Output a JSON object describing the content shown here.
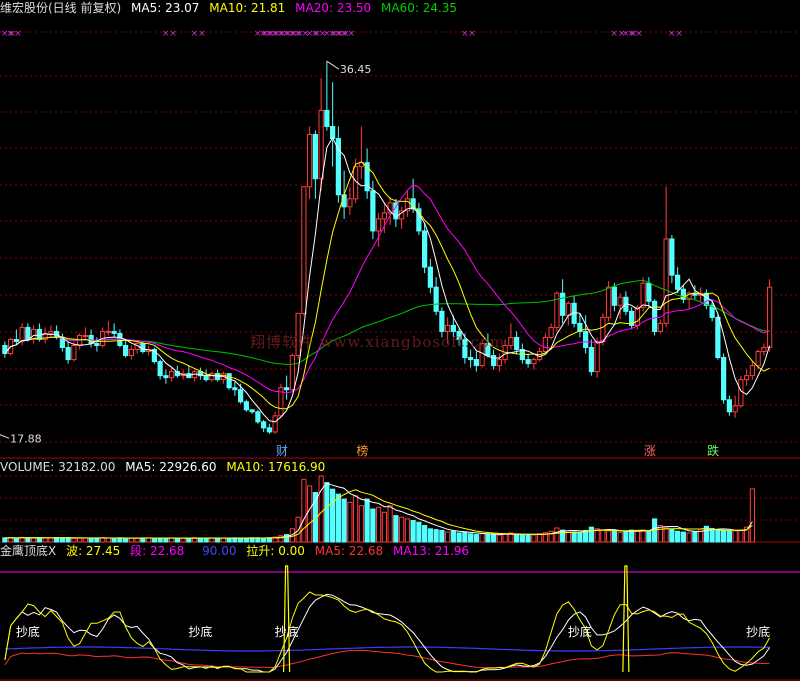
{
  "price_header": {
    "name": "维宏股份(日线 前复权)",
    "ma5": "MA5: 23.07",
    "ma10": "MA10: 21.81",
    "ma20": "MA20: 23.50",
    "ma60": "MA60: 24.35"
  },
  "volume_header": {
    "title": "VOLUME: 32182.00",
    "ma5": "MA5: 22926.60",
    "ma10": "MA10: 17616.90"
  },
  "indicator_header": {
    "title": "金鹰顶底X",
    "wave": "波: 27.45",
    "segment": "段: 22.68",
    "level": "90.00",
    "pull": "拉升: 0.00",
    "ma5": "MA5: 22.68",
    "ma13": "MA13: 21.96"
  },
  "annotations": {
    "high_label": "36.45",
    "low_label": "17.88",
    "markers": [
      "财",
      "榜",
      "涨",
      "跌"
    ],
    "signal_text": "抄底",
    "cross": "××",
    "watermark": "翔博软件 www.xiangbosoft.com"
  },
  "colors": {
    "up": "#ff3c3c",
    "down": "#54ffff",
    "ma5": "#ffffff",
    "ma10": "#ffff00",
    "ma20": "#ff00ff",
    "ma60": "#00c000",
    "grid": "#8b0000",
    "indicator_wave": "#ffff00",
    "indicator_segment": "#ffffff",
    "indicator_base": "#3c3cff",
    "indicator_mid": "#ff3030",
    "indicator_top": "#ff00ff"
  },
  "chart_data": [
    {
      "type": "candlestick",
      "title": "维宏股份(日线 前复权)",
      "ylim": [
        17,
        38
      ],
      "high_marker": 36.45,
      "low_marker": 17.88,
      "series": [
        {
          "name": "MA5"
        },
        {
          "name": "MA10"
        },
        {
          "name": "MA20"
        },
        {
          "name": "MA60"
        }
      ],
      "candles": [
        [
          22.3,
          22.5,
          21.7,
          21.9
        ],
        [
          21.9,
          22.7,
          21.8,
          22.6
        ],
        [
          22.6,
          23.1,
          22.3,
          22.5
        ],
        [
          22.5,
          23.4,
          22.3,
          23.2
        ],
        [
          23.2,
          23.4,
          22.5,
          22.6
        ],
        [
          22.6,
          23.3,
          22.4,
          23.1
        ],
        [
          23.1,
          23.4,
          22.5,
          22.6
        ],
        [
          22.6,
          23.2,
          22.4,
          22.9
        ],
        [
          22.9,
          23.3,
          22.7,
          23.0
        ],
        [
          23.0,
          23.3,
          22.6,
          22.7
        ],
        [
          22.7,
          22.9,
          22.0,
          22.2
        ],
        [
          22.2,
          22.5,
          21.4,
          21.6
        ],
        [
          21.6,
          22.5,
          21.5,
          22.3
        ],
        [
          22.3,
          22.9,
          22.1,
          22.8
        ],
        [
          22.8,
          23.2,
          22.6,
          22.8
        ],
        [
          22.8,
          23.1,
          22.2,
          22.4
        ],
        [
          22.4,
          22.7,
          22.0,
          22.3
        ],
        [
          22.3,
          23.2,
          22.2,
          23.0
        ],
        [
          23.0,
          23.5,
          22.8,
          23.0
        ],
        [
          23.0,
          23.4,
          22.7,
          22.9
        ],
        [
          22.9,
          23.1,
          22.2,
          22.3
        ],
        [
          22.3,
          22.6,
          21.7,
          21.8
        ],
        [
          21.8,
          22.3,
          21.6,
          22.1
        ],
        [
          22.1,
          22.5,
          21.9,
          22.4
        ],
        [
          22.4,
          22.5,
          21.9,
          22.0
        ],
        [
          22.0,
          22.3,
          21.8,
          22.1
        ],
        [
          22.1,
          22.2,
          21.4,
          21.5
        ],
        [
          21.5,
          21.6,
          20.6,
          20.8
        ],
        [
          20.8,
          21.1,
          20.4,
          20.7
        ],
        [
          20.7,
          21.2,
          20.5,
          21.0
        ],
        [
          21.0,
          21.3,
          20.7,
          20.8
        ],
        [
          20.8,
          21.1,
          20.6,
          20.9
        ],
        [
          20.9,
          21.3,
          20.7,
          20.7
        ],
        [
          20.7,
          21.1,
          20.5,
          21.0
        ],
        [
          21.0,
          21.2,
          20.6,
          20.8
        ],
        [
          20.8,
          21.1,
          20.5,
          20.6
        ],
        [
          20.6,
          21.0,
          20.5,
          20.9
        ],
        [
          20.9,
          21.1,
          20.5,
          20.6
        ],
        [
          20.6,
          21.0,
          20.4,
          20.9
        ],
        [
          20.9,
          20.9,
          20.1,
          20.2
        ],
        [
          20.2,
          20.5,
          19.8,
          20.1
        ],
        [
          20.1,
          20.4,
          19.4,
          19.5
        ],
        [
          19.5,
          19.6,
          19.0,
          19.1
        ],
        [
          19.1,
          19.1,
          18.9,
          19.0
        ],
        [
          19.0,
          19.1,
          18.4,
          18.5
        ],
        [
          18.5,
          18.6,
          18.0,
          18.2
        ],
        [
          18.2,
          18.4,
          17.9,
          18.0
        ],
        [
          18.0,
          19.0,
          17.9,
          18.8
        ],
        [
          18.8,
          20.4,
          18.7,
          20.2
        ],
        [
          20.2,
          20.8,
          19.6,
          20.1
        ],
        [
          20.1,
          21.9,
          20.0,
          21.8
        ],
        [
          21.8,
          23.9,
          21.6,
          23.9
        ],
        [
          23.9,
          30.2,
          23.8,
          30.2
        ],
        [
          30.2,
          33.2,
          29.6,
          32.8
        ],
        [
          32.8,
          33.0,
          29.6,
          30.6
        ],
        [
          30.6,
          35.6,
          30.0,
          34.0
        ],
        [
          34.0,
          36.45,
          33.0,
          33.2
        ],
        [
          33.2,
          35.4,
          31.2,
          32.6
        ],
        [
          32.6,
          33.2,
          29.4,
          29.8
        ],
        [
          29.8,
          31.0,
          28.6,
          29.2
        ],
        [
          29.2,
          30.2,
          28.8,
          29.6
        ],
        [
          29.6,
          31.6,
          29.4,
          31.2
        ],
        [
          31.2,
          33.2,
          30.6,
          31.4
        ],
        [
          31.4,
          32.1,
          29.6,
          30.0
        ],
        [
          30.0,
          30.5,
          27.6,
          28.0
        ],
        [
          28.0,
          28.9,
          27.2,
          28.6
        ],
        [
          28.6,
          29.4,
          27.9,
          28.9
        ],
        [
          28.9,
          29.7,
          28.3,
          29.4
        ],
        [
          29.4,
          29.6,
          28.2,
          28.6
        ],
        [
          28.6,
          29.2,
          28.1,
          29.0
        ],
        [
          29.0,
          30.0,
          28.7,
          29.6
        ],
        [
          29.6,
          30.6,
          28.9,
          29.1
        ],
        [
          29.1,
          29.4,
          27.8,
          28.0
        ],
        [
          28.0,
          28.4,
          25.9,
          26.2
        ],
        [
          26.2,
          26.6,
          24.9,
          25.2
        ],
        [
          25.2,
          25.7,
          23.8,
          24.0
        ],
        [
          24.0,
          24.2,
          22.7,
          23.0
        ],
        [
          23.0,
          23.7,
          22.4,
          23.3
        ],
        [
          23.3,
          23.8,
          22.7,
          23.0
        ],
        [
          23.0,
          23.2,
          22.3,
          22.6
        ],
        [
          22.6,
          22.9,
          21.4,
          21.7
        ],
        [
          21.7,
          22.1,
          21.2,
          21.6
        ],
        [
          21.6,
          22.0,
          21.0,
          21.3
        ],
        [
          21.3,
          22.6,
          21.2,
          22.4
        ],
        [
          22.4,
          22.9,
          21.7,
          21.8
        ],
        [
          21.8,
          22.1,
          21.1,
          21.3
        ],
        [
          21.3,
          21.9,
          21.0,
          21.6
        ],
        [
          21.6,
          22.6,
          21.4,
          22.3
        ],
        [
          22.3,
          23.4,
          22.1,
          22.7
        ],
        [
          22.7,
          23.0,
          21.9,
          22.1
        ],
        [
          22.1,
          22.4,
          21.4,
          21.6
        ],
        [
          21.6,
          21.9,
          21.2,
          21.4
        ],
        [
          21.4,
          21.7,
          21.1,
          21.6
        ],
        [
          21.6,
          22.2,
          21.5,
          22.0
        ],
        [
          22.0,
          22.9,
          21.9,
          22.7
        ],
        [
          22.7,
          23.4,
          22.6,
          23.2
        ],
        [
          23.2,
          25.0,
          23.0,
          24.9
        ],
        [
          24.9,
          25.6,
          23.4,
          23.8
        ],
        [
          23.8,
          24.5,
          23.3,
          24.4
        ],
        [
          24.4,
          24.8,
          23.2,
          23.4
        ],
        [
          23.4,
          23.9,
          22.7,
          23.0
        ],
        [
          23.0,
          23.8,
          21.9,
          22.2
        ],
        [
          22.2,
          22.6,
          20.8,
          21.0
        ],
        [
          21.0,
          22.7,
          20.7,
          22.5
        ],
        [
          22.5,
          23.9,
          22.3,
          23.7
        ],
        [
          23.7,
          25.5,
          23.5,
          25.2
        ],
        [
          25.2,
          25.4,
          24.0,
          24.3
        ],
        [
          24.3,
          24.9,
          23.6,
          24.7
        ],
        [
          24.7,
          25.0,
          23.8,
          24.0
        ],
        [
          24.0,
          24.2,
          23.1,
          23.3
        ],
        [
          23.3,
          24.3,
          23.1,
          24.2
        ],
        [
          24.2,
          25.7,
          24.0,
          25.4
        ],
        [
          25.4,
          25.7,
          24.2,
          24.5
        ],
        [
          24.5,
          24.6,
          22.8,
          23.0
        ],
        [
          23.0,
          23.6,
          22.9,
          23.4
        ],
        [
          23.4,
          30.2,
          23.2,
          27.6
        ],
        [
          27.6,
          27.8,
          25.4,
          25.8
        ],
        [
          25.8,
          26.2,
          24.9,
          25.1
        ],
        [
          25.1,
          25.3,
          24.4,
          24.6
        ],
        [
          24.6,
          25.0,
          24.1,
          24.9
        ],
        [
          24.9,
          25.3,
          24.6,
          24.8
        ],
        [
          24.8,
          25.2,
          24.5,
          24.9
        ],
        [
          24.9,
          25.1,
          24.1,
          24.3
        ],
        [
          24.3,
          24.6,
          23.5,
          23.7
        ],
        [
          23.7,
          23.9,
          21.6,
          21.7
        ],
        [
          21.7,
          21.9,
          19.4,
          19.6
        ],
        [
          19.6,
          19.8,
          18.8,
          19.0
        ],
        [
          19.0,
          19.8,
          18.7,
          19.3
        ],
        [
          19.3,
          20.8,
          19.2,
          20.6
        ],
        [
          20.6,
          21.1,
          20.3,
          20.8
        ],
        [
          20.8,
          21.5,
          20.6,
          21.3
        ],
        [
          21.3,
          22.1,
          21.1,
          22.0
        ],
        [
          22.0,
          22.4,
          21.8,
          22.2
        ],
        [
          22.2,
          25.6,
          22.0,
          25.2
        ]
      ]
    },
    {
      "type": "bar",
      "title": "VOLUME",
      "values": [
        2500,
        2600,
        2400,
        2800,
        2500,
        2300,
        2600,
        2400,
        2500,
        2700,
        2400,
        2600,
        2200,
        2500,
        2400,
        2300,
        2500,
        2600,
        2400,
        2300,
        2500,
        2200,
        2400,
        2300,
        2500,
        2600,
        2400,
        2300,
        2200,
        2500,
        2300,
        2400,
        2200,
        2600,
        2300,
        2400,
        2500,
        2300,
        2400,
        2200,
        2500,
        2400,
        2300,
        2600,
        2500,
        2400,
        2600,
        3000,
        3800,
        4500,
        8000,
        15000,
        38000,
        34000,
        30000,
        40000,
        36000,
        32000,
        29000,
        26000,
        24000,
        28000,
        22000,
        26000,
        20000,
        21000,
        18000,
        22000,
        16000,
        15000,
        14000,
        13000,
        12000,
        10000,
        8000,
        7500,
        7000,
        6000,
        6500,
        5500,
        6000,
        5000,
        4500,
        5000,
        4800,
        4500,
        4200,
        4800,
        5500,
        4700,
        4500,
        4200,
        4300,
        5000,
        5600,
        6500,
        8500,
        7200,
        6800,
        6000,
        5500,
        7000,
        9000,
        8000,
        7200,
        6800,
        6500,
        5900,
        6300,
        7200,
        6600,
        7300,
        6800,
        14000,
        10000,
        8500,
        7800,
        6500,
        6000,
        5500,
        6200,
        7800,
        9500,
        8200,
        7500,
        6800,
        6500,
        6800,
        7200,
        9000,
        32182
      ]
    },
    {
      "type": "line",
      "title": "金鹰顶底X",
      "series": [
        {
          "name": "波"
        },
        {
          "name": "段"
        },
        {
          "name": "MA5"
        },
        {
          "name": "MA13"
        }
      ]
    }
  ]
}
